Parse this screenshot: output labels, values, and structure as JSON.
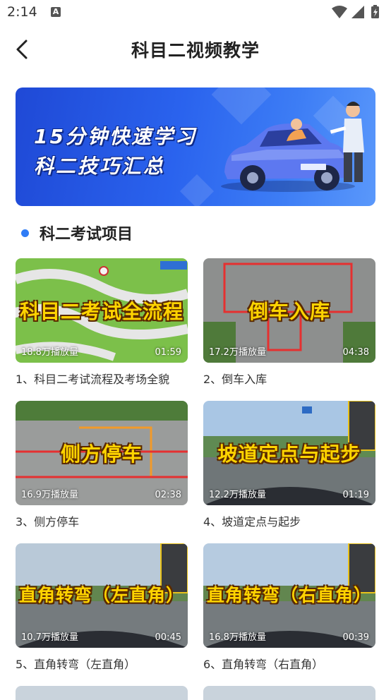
{
  "status_bar": {
    "time": "2:14",
    "notification_letter": "A"
  },
  "header": {
    "title": "科目二视频教学"
  },
  "banner": {
    "line1": "15分钟快速学习",
    "line2": "科二技巧汇总"
  },
  "section": {
    "title": "科二考试项目"
  },
  "colors": {
    "accent": "#2f7cf6",
    "caption": "#ffd400",
    "banner": "#2a63ee"
  },
  "videos": [
    {
      "caption": "科目二考试全流程",
      "views": "18.8万播放量",
      "duration": "01:59",
      "title": "1、科目二考试流程及考场全貌"
    },
    {
      "caption": "倒车入库",
      "views": "17.2万播放量",
      "duration": "04:38",
      "title": "2、倒车入库"
    },
    {
      "caption": "侧方停车",
      "views": "16.9万播放量",
      "duration": "02:38",
      "title": "3、侧方停车"
    },
    {
      "caption": "坡道定点与起步",
      "views": "12.2万播放量",
      "duration": "01:19",
      "title": "4、坡道定点与起步"
    },
    {
      "caption": "直角转弯（左直角）",
      "views": "10.7万播放量",
      "duration": "00:45",
      "title": "5、直角转弯（左直角）"
    },
    {
      "caption": "直角转弯（右直角）",
      "views": "16.8万播放量",
      "duration": "00:39",
      "title": "6、直角转弯（右直角）"
    }
  ]
}
